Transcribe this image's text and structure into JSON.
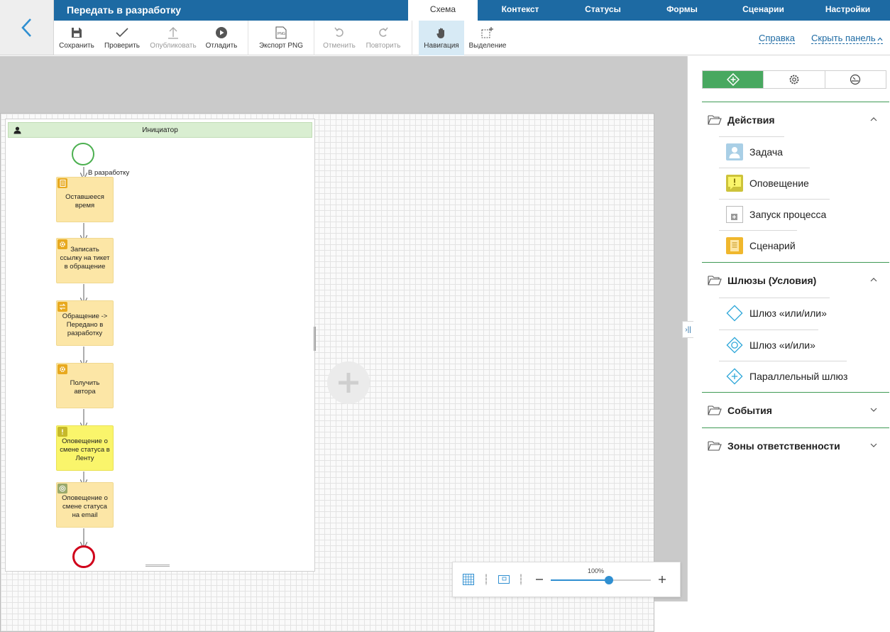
{
  "app": {
    "title": "Передать в разработку"
  },
  "tabs": [
    {
      "label": "Схема",
      "active": true
    },
    {
      "label": "Контекст"
    },
    {
      "label": "Статусы"
    },
    {
      "label": "Формы"
    },
    {
      "label": "Сценарии"
    },
    {
      "label": "Настройки"
    }
  ],
  "toolbar": {
    "save": "Сохранить",
    "check": "Проверить",
    "publish": "Опубликовать",
    "debug": "Отладить",
    "export_png": "Экспорт PNG",
    "export_icon_text": "PNG",
    "undo": "Отменить",
    "redo": "Повторить",
    "navigation": "Навигация",
    "selection": "Выделение",
    "help": "Справка",
    "hide_panel": "Скрыть панель"
  },
  "canvas": {
    "lane_title": "Инициатор",
    "flow_label": "В разработку",
    "nodes": [
      {
        "text": "Оставшееся время",
        "kind": "script"
      },
      {
        "text": "Записать ссылку на тикет в обращение",
        "kind": "auto"
      },
      {
        "text": "Обращение -> Передано в разработку",
        "kind": "status"
      },
      {
        "text": "Получить автора",
        "kind": "auto"
      },
      {
        "text": "Оповещение о смене статуса в Ленту",
        "kind": "notify"
      },
      {
        "text": "Оповещение о смене статуса на email",
        "kind": "email"
      }
    ]
  },
  "zoom": {
    "label": "100%",
    "level": 0.58
  },
  "panel": {
    "sections": [
      {
        "title": "Действия",
        "expanded": true,
        "items": [
          "Задача",
          "Оповещение",
          "Запуск процесса",
          "Сценарий"
        ]
      },
      {
        "title": "Шлюзы (Условия)",
        "expanded": true,
        "items": [
          "Шлюз «или/или»",
          "Шлюз «и/или»",
          "Параллельный шлюз"
        ]
      },
      {
        "title": "События",
        "expanded": false
      },
      {
        "title": "Зоны ответственности",
        "expanded": false
      }
    ]
  },
  "colors": {
    "header": "#1d6aa3",
    "accent_green": "#48a860",
    "task_fill": "#fce6a6",
    "notify_fill": "#faf56b",
    "start": "#4cb050",
    "end": "#d0021b",
    "gateway": "#2ea7d9"
  }
}
